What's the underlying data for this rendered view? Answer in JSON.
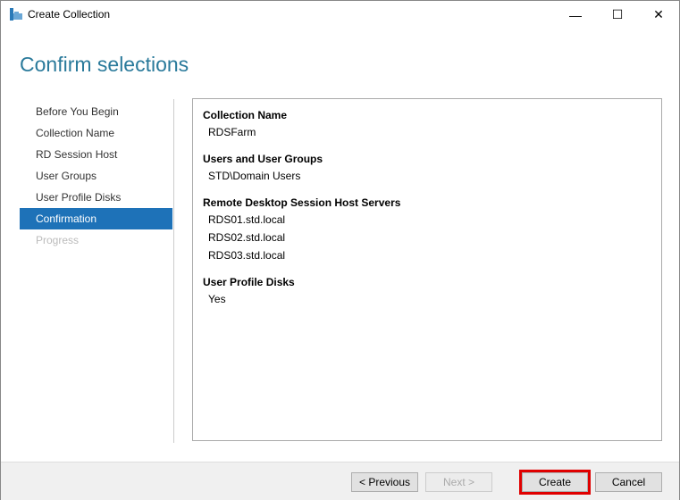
{
  "window": {
    "title": "Create Collection",
    "minimize": "—",
    "maximize": "☐",
    "close": "✕"
  },
  "heading": "Confirm selections",
  "nav": [
    {
      "label": "Before You Begin",
      "state": "normal"
    },
    {
      "label": "Collection Name",
      "state": "normal"
    },
    {
      "label": "RD Session Host",
      "state": "normal"
    },
    {
      "label": "User Groups",
      "state": "normal"
    },
    {
      "label": "User Profile Disks",
      "state": "normal"
    },
    {
      "label": "Confirmation",
      "state": "active"
    },
    {
      "label": "Progress",
      "state": "disabled"
    }
  ],
  "sections": [
    {
      "title": "Collection Name",
      "values": [
        "RDSFarm"
      ]
    },
    {
      "title": "Users and User Groups",
      "values": [
        "STD\\Domain Users"
      ]
    },
    {
      "title": "Remote Desktop Session Host Servers",
      "values": [
        "RDS01.std.local",
        "RDS02.std.local",
        "RDS03.std.local"
      ]
    },
    {
      "title": "User Profile Disks",
      "values": [
        "Yes"
      ]
    }
  ],
  "buttons": {
    "previous": "< Previous",
    "next": "Next >",
    "create": "Create",
    "cancel": "Cancel"
  },
  "colors": {
    "accent": "#1e72b8",
    "heading": "#2a7a9b",
    "highlight": "#e00000"
  }
}
